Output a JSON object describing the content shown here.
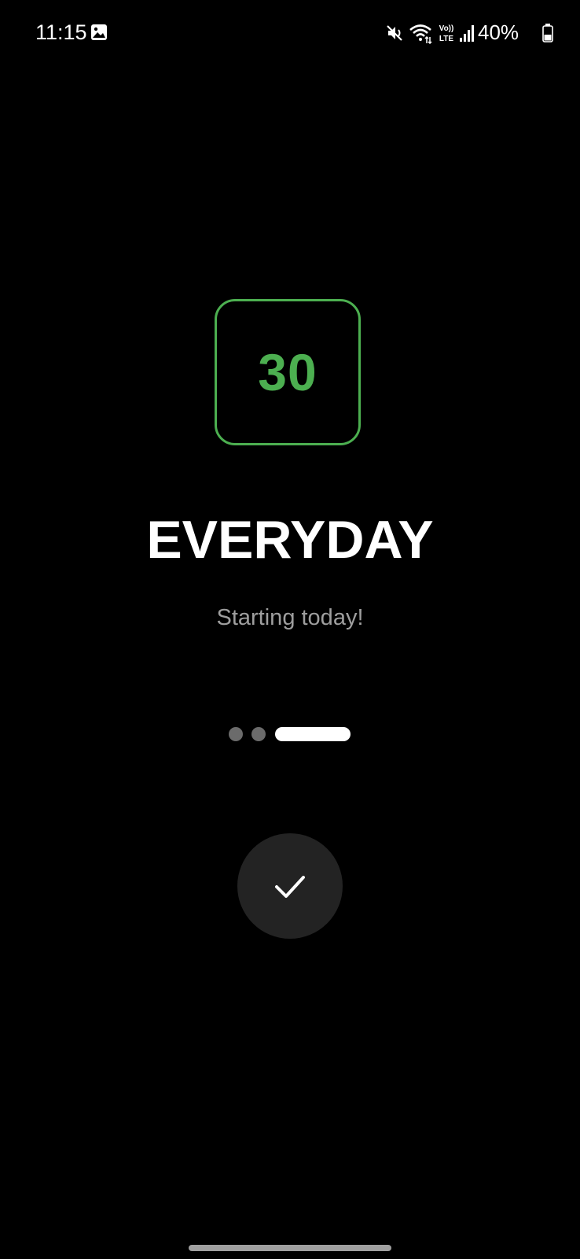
{
  "status_bar": {
    "time": "11:15",
    "battery_percent": "40%",
    "battery_level": 0.4,
    "icons": [
      "gallery-icon",
      "mute-icon",
      "wifi-icon",
      "volte-icon",
      "signal-icon",
      "battery-icon"
    ],
    "volte_label_top": "Vo))",
    "volte_label_bottom": "LTE"
  },
  "main": {
    "day_count": "30",
    "title": "EVERYDAY",
    "subtitle": "Starting today!"
  },
  "pager": {
    "total_pages": 3,
    "active_page": 3
  },
  "confirm_button": {
    "icon": "check-icon"
  },
  "colors": {
    "background": "#000000",
    "accent": "#4caf50",
    "subtitle": "#9e9e9e",
    "button_bg": "#232323",
    "dot_inactive": "#6b6b6b",
    "dot_active": "#ffffff"
  }
}
